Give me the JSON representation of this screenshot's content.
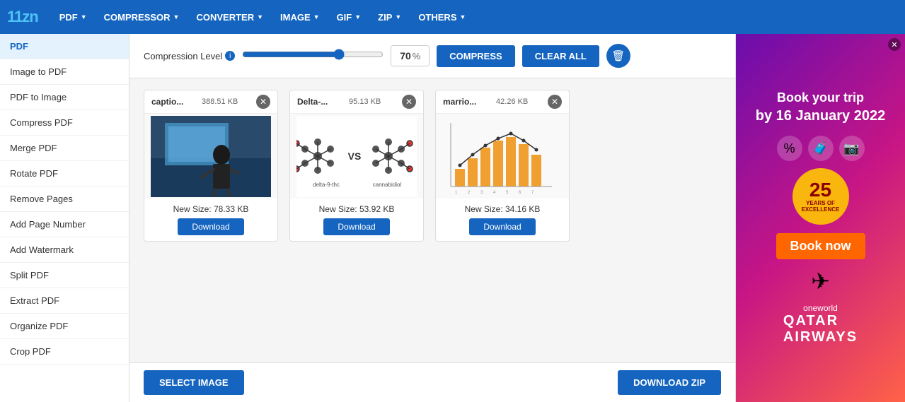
{
  "logo": {
    "text1": "11z",
    "text2": "n"
  },
  "nav": {
    "items": [
      {
        "label": "PDF",
        "hasArrow": true
      },
      {
        "label": "COMPRESSOR",
        "hasArrow": true
      },
      {
        "label": "CONVERTER",
        "hasArrow": true
      },
      {
        "label": "IMAGE",
        "hasArrow": true
      },
      {
        "label": "GIF",
        "hasArrow": true
      },
      {
        "label": "ZIP",
        "hasArrow": true
      },
      {
        "label": "OTHERS",
        "hasArrow": true
      }
    ]
  },
  "sidebar": {
    "items": [
      {
        "label": "PDF",
        "active": true
      },
      {
        "label": "Image to PDF"
      },
      {
        "label": "PDF to Image"
      },
      {
        "label": "Compress PDF"
      },
      {
        "label": "Merge PDF"
      },
      {
        "label": "Rotate PDF"
      },
      {
        "label": "Remove Pages"
      },
      {
        "label": "Add Page Number"
      },
      {
        "label": "Add Watermark"
      },
      {
        "label": "Split PDF"
      },
      {
        "label": "Extract PDF"
      },
      {
        "label": "Organize PDF"
      },
      {
        "label": "Crop PDF"
      }
    ]
  },
  "compression": {
    "label": "Compression Level",
    "value": 70,
    "percent_symbol": "%",
    "compress_btn": "COMPRESS",
    "clear_btn": "CLEAR ALL"
  },
  "files": [
    {
      "name": "captio...",
      "size": "388.51 KB",
      "new_size": "New Size: 78.33 KB",
      "download_label": "Download",
      "preview_type": "person"
    },
    {
      "name": "Delta-...",
      "size": "95.13 KB",
      "new_size": "New Size: 53.92 KB",
      "download_label": "Download",
      "preview_type": "molecule"
    },
    {
      "name": "marrio...",
      "size": "42.26 KB",
      "new_size": "New Size: 34.16 KB",
      "download_label": "Download",
      "preview_type": "chart"
    }
  ],
  "bottom": {
    "select_btn": "SELECT IMAGE",
    "download_zip_btn": "DOWNLOAD ZIP"
  },
  "ad": {
    "title": "Book your trip",
    "date": "by 16 January 2022",
    "years_num": "25",
    "years_text": "YEARS OF\nEXCELLENCE",
    "book_now": "Book now",
    "brand": "oneworld",
    "brand_name": "QATAR\nAIRWAYS"
  }
}
